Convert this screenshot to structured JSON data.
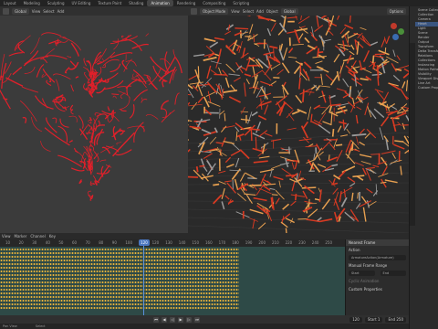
{
  "workspace_tabs": [
    "Layout",
    "Modeling",
    "Sculpting",
    "UV Editing",
    "Texture Paint",
    "Shading",
    "Animation",
    "Rendering",
    "Compositing",
    "Scripting"
  ],
  "active_tab_index": 6,
  "left_header": {
    "mode": "Global",
    "view": "View",
    "select": "Select",
    "add": "Add"
  },
  "right_header": {
    "mode": "Object Mode",
    "view": "View",
    "select": "Select",
    "add": "Add",
    "object": "Object",
    "transform": "Global",
    "options": "Options"
  },
  "props": {
    "rows": [
      "Scene Collection",
      "Collection",
      "Camera",
      "Heart",
      "Light",
      "Scene",
      "Render",
      "Output",
      "Transform",
      "Delta Transform",
      "Relations",
      "Collections",
      "Instancing",
      "Motion Paths",
      "Visibility",
      "Viewport Display",
      "Line Art",
      "Custom Properties"
    ]
  },
  "timeline": {
    "menus": [
      "View",
      "Marker",
      "Channel",
      "Key"
    ],
    "ruler": [
      "10",
      "20",
      "30",
      "40",
      "50",
      "60",
      "70",
      "80",
      "90",
      "100",
      "110",
      "120",
      "130",
      "140",
      "150",
      "160",
      "170",
      "180",
      "190",
      "200",
      "210",
      "220",
      "230",
      "240",
      "250"
    ],
    "current_frame": "120"
  },
  "nla_panel": {
    "tab": "Nearest Frame",
    "action_section": "Action",
    "action_name": "ArmatureAction(Armature)",
    "manual_frame_range": "Manual Frame Range",
    "start_label": "Start",
    "end_label": "End",
    "cyclic": "Cyclic Animation",
    "custom_props": "Custom Properties"
  },
  "playback": {
    "start_label": "Start",
    "start": "1",
    "end_label": "End",
    "end": "250",
    "frame": "120"
  },
  "status": {
    "left": "Pan View",
    "mid": "Select",
    "right": ""
  },
  "colors": {
    "strands_left": "#e0202a",
    "strands_right": "#d83a22",
    "highlight_right": "#e8a050",
    "keyframe": "#e8b23a",
    "accent": "#4a77c1"
  }
}
